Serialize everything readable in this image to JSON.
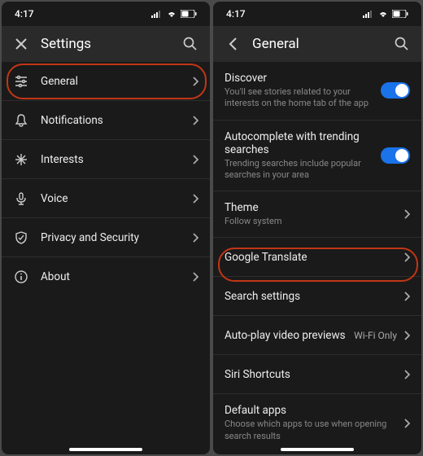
{
  "status": {
    "time": "4:17"
  },
  "left": {
    "title": "Settings",
    "items": [
      {
        "label": "General"
      },
      {
        "label": "Notifications"
      },
      {
        "label": "Interests"
      },
      {
        "label": "Voice"
      },
      {
        "label": "Privacy and Security"
      },
      {
        "label": "About"
      }
    ]
  },
  "right": {
    "title": "General",
    "items": [
      {
        "label": "Discover",
        "sub": "You'll see stories related to your interests on the home tab of the app"
      },
      {
        "label": "Autocomplete with trending searches",
        "sub": "Trending searches include popular searches in your area"
      },
      {
        "label": "Theme",
        "sub": "Follow system"
      },
      {
        "label": "Google Translate"
      },
      {
        "label": "Search settings"
      },
      {
        "label": "Auto-play video previews",
        "value": "Wi-Fi Only"
      },
      {
        "label": "Siri Shortcuts"
      },
      {
        "label": "Default apps",
        "sub": "Choose which apps to use when opening search results"
      }
    ]
  }
}
